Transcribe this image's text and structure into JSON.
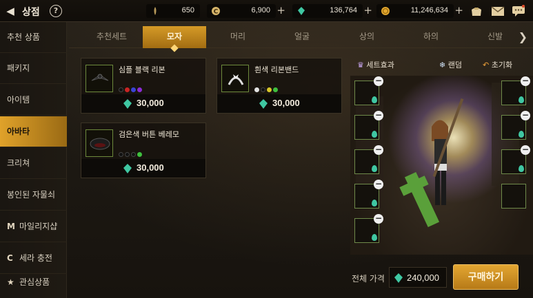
{
  "header": {
    "title": "상점",
    "help": "?",
    "currencies": [
      {
        "icon": "feather-icon",
        "value": "650"
      },
      {
        "icon": "cera-coin-icon",
        "value": "6,900"
      },
      {
        "icon": "gem-icon",
        "value": "136,764"
      },
      {
        "icon": "gold-icon",
        "value": "11,246,634"
      }
    ]
  },
  "sidebar": {
    "items": [
      {
        "label": "추천 상품"
      },
      {
        "label": "패키지"
      },
      {
        "label": "아이템"
      },
      {
        "label": "아바타"
      },
      {
        "label": "크리쳐"
      },
      {
        "label": "봉인된 자물쇠"
      },
      {
        "prefix": "M",
        "label": "마일리지샵"
      },
      {
        "prefix": "C",
        "label": "세라 충전"
      },
      {
        "prefix": "★",
        "label": "관심상품"
      }
    ]
  },
  "tabs": [
    "추천세트",
    "모자",
    "머리",
    "얼굴",
    "상의",
    "하의",
    "신발"
  ],
  "products": [
    {
      "name": "심플 블랙 리본",
      "price": "30,000",
      "colors": [
        "#111111",
        "#c92424",
        "#3a43d6",
        "#8a2bd6"
      ]
    },
    {
      "name": "흰색 리본밴드",
      "price": "30,000",
      "colors": [
        "#e2e2e2",
        "#111111",
        "#d8c72a",
        "#3fc03f"
      ]
    },
    {
      "name": "검은색 버튼 베레모",
      "price": "30,000",
      "colors": [
        "#111111",
        "#111111",
        "#111111",
        "#3fc03f"
      ]
    }
  ],
  "preview": {
    "set_effect": "세트효과",
    "random": "랜덤",
    "reset": "초기화"
  },
  "footer": {
    "total_label": "전체 가격",
    "total_value": "240,000",
    "buy_label": "구매하기"
  },
  "colors": {
    "accent": "#d59a27",
    "gem": "#3fc7a2"
  }
}
